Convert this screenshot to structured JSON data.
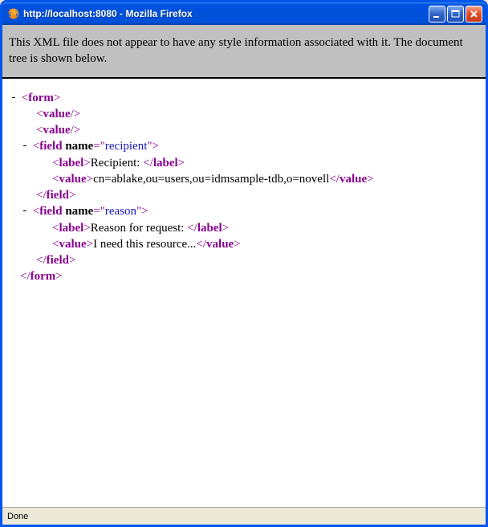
{
  "window": {
    "title": "http://localhost:8080 - Mozilla Firefox"
  },
  "notice": "This XML file does not appear to have any style information associated with it. The document tree is shown below.",
  "xml": {
    "root": "form",
    "emptyValue": "value",
    "field1": {
      "tag": "field",
      "attrName": "name",
      "attrValue": "recipient",
      "labelTag": "label",
      "labelText": "Recipient: ",
      "valueTag": "value",
      "valueText": "cn=ablake,ou=users,ou=idmsample-tdb,o=novell"
    },
    "field2": {
      "tag": "field",
      "attrName": "name",
      "attrValue": "reason",
      "labelTag": "label",
      "labelText": "Reason for request: ",
      "valueTag": "value",
      "valueText": "I need this resource..."
    }
  },
  "status": {
    "text": "Done"
  }
}
